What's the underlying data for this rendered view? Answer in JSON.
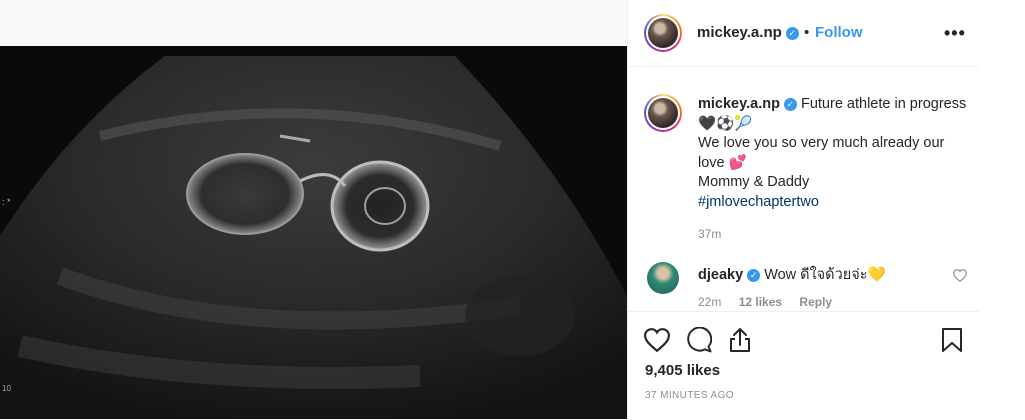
{
  "post": {
    "username": "mickey.a.np",
    "verified_mark": "✓",
    "dot": "•",
    "follow_label": "Follow",
    "more_label": "•••"
  },
  "caption": {
    "username": "mickey.a.np",
    "line1": "Future athlete in progress 🖤⚽🎾",
    "line2": "We love you so very much already our love 💕",
    "line3": "Mommy & Daddy",
    "hashtag": "#jmlovechaptertwo",
    "time": "37m"
  },
  "comment": {
    "username": "djeaky",
    "text": "Wow ดีใจด้วยจ่ะ💛",
    "time": "22m",
    "likes": "12 likes",
    "reply": "Reply"
  },
  "stats": {
    "likes": "9,405 likes",
    "posted": "37 MINUTES AGO"
  },
  "media": {
    "edge_marks": ":\n*",
    "edge_num": "10"
  },
  "icons": [
    "heart-icon",
    "comment-icon",
    "share-icon",
    "bookmark-icon",
    "more-icon",
    "verified-icon"
  ],
  "colors": {
    "link": "#3897f0",
    "hashtag": "#003569",
    "muted": "#8e8e8e",
    "text": "#262626"
  }
}
